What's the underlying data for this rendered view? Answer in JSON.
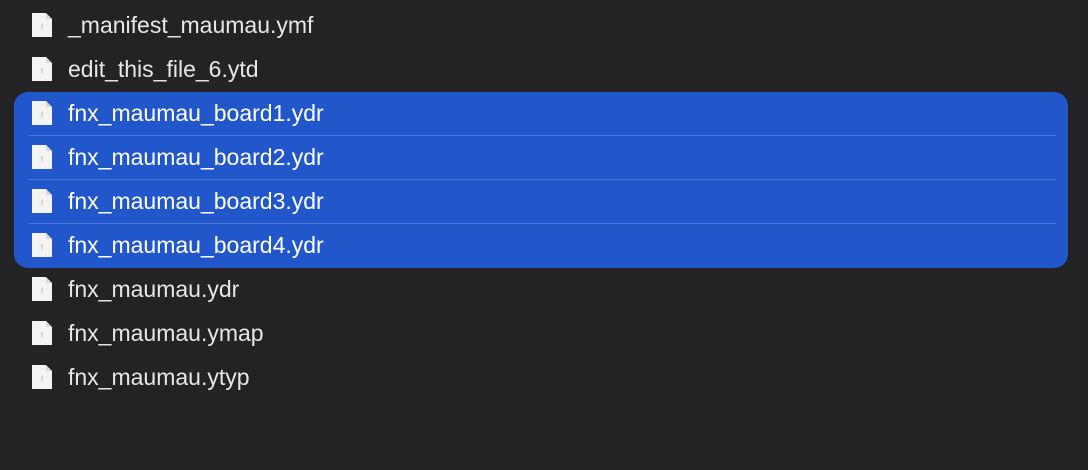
{
  "files": [
    {
      "name": "_manifest_maumau.ymf",
      "icon": "document-icon",
      "selected": false
    },
    {
      "name": "edit_this_file_6.ytd",
      "icon": "document-icon",
      "selected": false
    },
    {
      "name": "fnx_maumau_board1.ydr",
      "icon": "document-icon",
      "selected": true
    },
    {
      "name": "fnx_maumau_board2.ydr",
      "icon": "document-icon",
      "selected": true
    },
    {
      "name": "fnx_maumau_board3.ydr",
      "icon": "document-icon",
      "selected": true
    },
    {
      "name": "fnx_maumau_board4.ydr",
      "icon": "document-icon",
      "selected": true
    },
    {
      "name": "fnx_maumau.ydr",
      "icon": "document-icon",
      "selected": false
    },
    {
      "name": "fnx_maumau.ymap",
      "icon": "document-icon",
      "selected": false
    },
    {
      "name": "fnx_maumau.ytyp",
      "icon": "document-icon",
      "selected": false
    }
  ],
  "colors": {
    "background": "#232326",
    "selection": "#2257CC",
    "text": "#E7E7E9",
    "icon_page": "#F4F4F4",
    "icon_fold": "#D8D8D8"
  }
}
